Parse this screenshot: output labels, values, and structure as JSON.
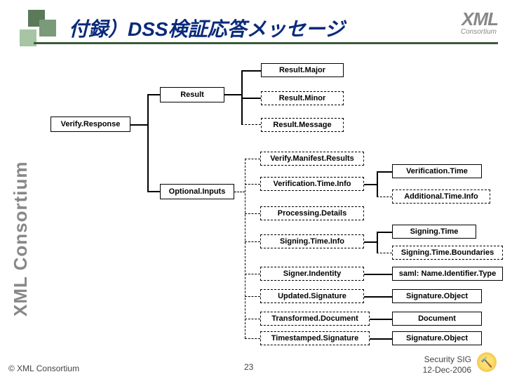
{
  "title": "付録）DSS検証応答メッセージ",
  "logo": {
    "text": "XML",
    "sub": "Consortium"
  },
  "sidebar": "XML Consortium",
  "nodes": {
    "verifyResponse": "Verify.Response",
    "result": "Result",
    "optionalInputs": "Optional.Inputs",
    "resultMajor": "Result.Major",
    "resultMinor": "Result.Minor",
    "resultMessage": "Result.Message",
    "verifyManifestResults": "Verify.Manifest.Results",
    "verificationTimeInfo": "Verification.Time.Info",
    "processingDetails": "Processing.Details",
    "signingTimeInfo": "Signing.Time.Info",
    "signerIdentity": "Signer.Indentity",
    "updatedSignature": "Updated.Signature",
    "transformedDocument": "Transformed.Document",
    "timestampedSignature": "Timestamped.Signature",
    "verificationTime": "Verification.Time",
    "additionalTimeInfo": "Additional.Time.Info",
    "signingTime": "Signing.Time",
    "signingTimeBoundaries": "Signing.Time.Boundaries",
    "samlNameIdentifierType": "saml: Name.Identifier.Type",
    "signatureObject1": "Signature.Object",
    "document": "Document",
    "signatureObject2": "Signature.Object"
  },
  "footer": {
    "left": "© XML Consortium",
    "center": "23",
    "right1": "Security SIG",
    "right2": "12-Dec-2006"
  }
}
